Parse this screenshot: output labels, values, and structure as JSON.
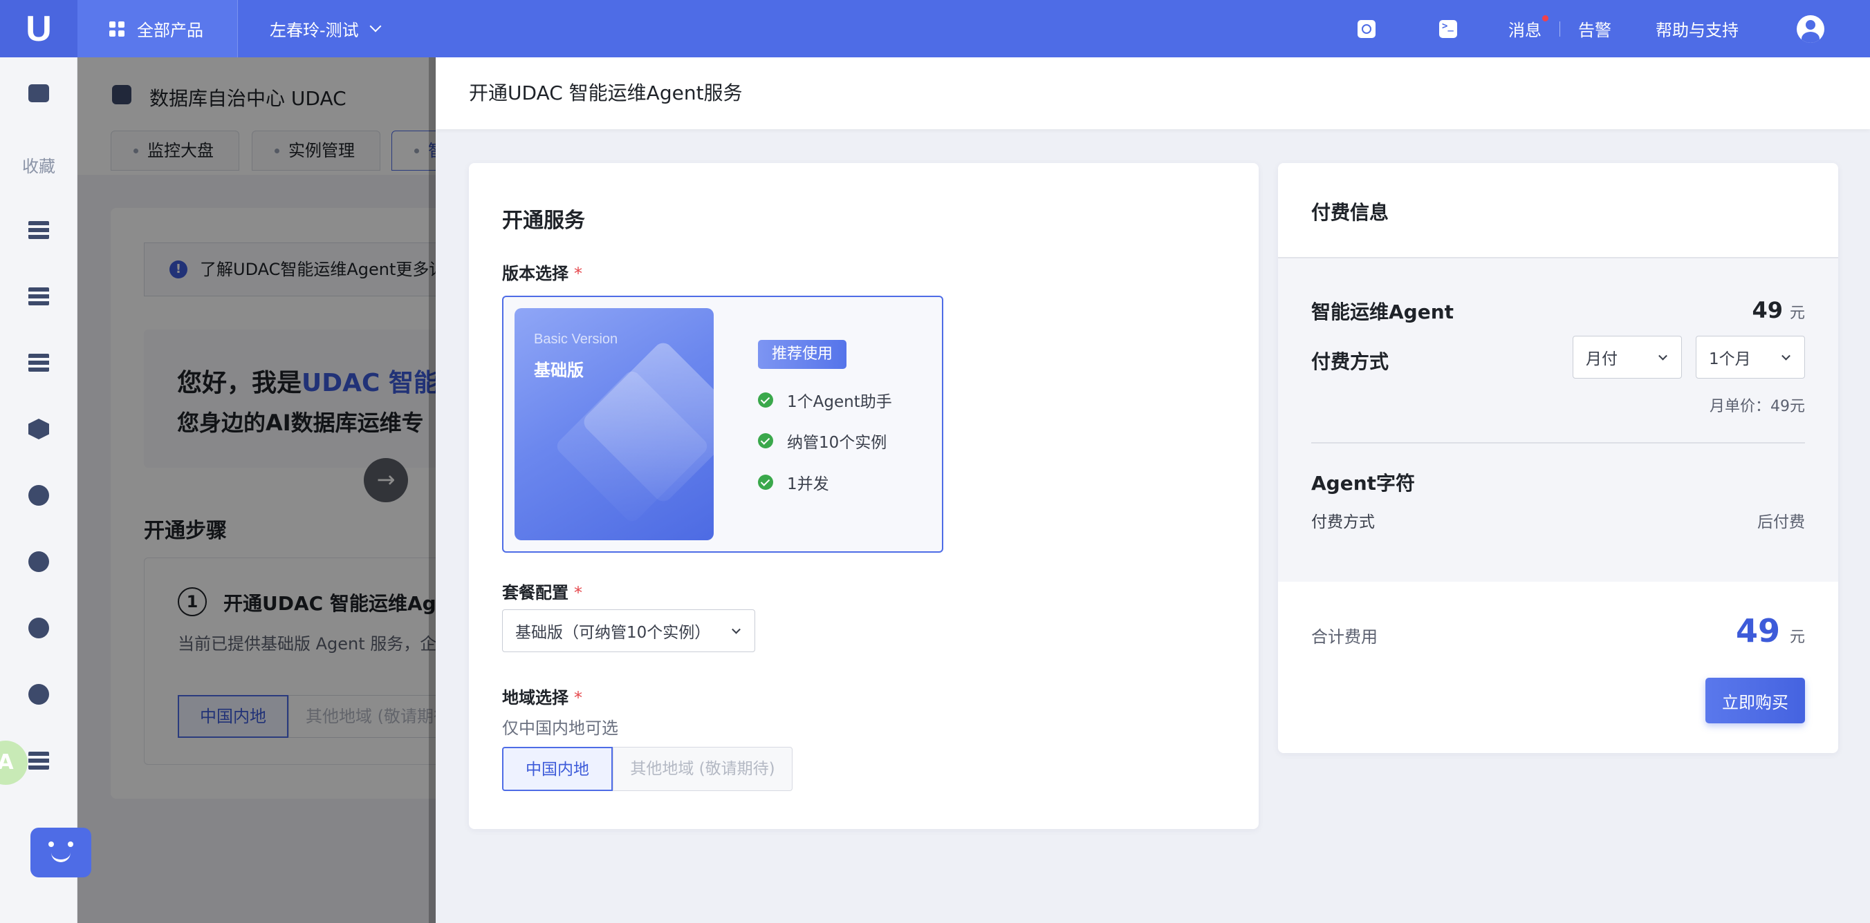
{
  "topbar": {
    "logo": "U",
    "all_products": "全部产品",
    "project": "左春玲-测试",
    "message": "消息",
    "alarm": "告警",
    "help": "帮助与支持"
  },
  "sidebar": {
    "favorites": "收藏",
    "translate_badge": "A"
  },
  "background_page": {
    "title": "数据库自治中心 UDAC",
    "tabs": [
      "监控大盘",
      "实例管理",
      "智"
    ],
    "notice": "了解UDAC智能运维Agent更多详",
    "hero_line1_prefix": "您好，我是",
    "hero_line1_highlight": "UDAC 智能运",
    "hero_line2": "您身边的AI数据库运维专",
    "steps_title": "开通步骤",
    "step_number": "1",
    "step_title": "开通UDAC 智能运维Agent",
    "step_desc": "当前已提供基础版 Agent 服务，企业",
    "region_active": "中国内地",
    "region_other": "其他地域 (敬请期待)"
  },
  "drawer": {
    "title": "开通UDAC 智能运维Agent服务",
    "service": {
      "title": "开通服务",
      "version_label": "版本选择",
      "required_mark": "*",
      "version": {
        "name_en": "Basic Version",
        "name_cn": "基础版",
        "badge": "推荐使用",
        "features": [
          "1个Agent助手",
          "纳管10个实例",
          "1并发"
        ]
      },
      "package_label": "套餐配置",
      "package_value": "基础版（可纳管10个实例）",
      "region_label": "地域选择",
      "region_hint": "仅中国内地可选",
      "region_options": [
        "中国内地",
        "其他地域 (敬请期待)"
      ]
    },
    "payment": {
      "title": "付费信息",
      "agent_name": "智能运维Agent",
      "agent_price": "49",
      "currency": "元",
      "pay_method_label": "付费方式",
      "pay_method_value": "月付",
      "duration_value": "1个月",
      "unit_price": "月单价：49元",
      "chars_title": "Agent字符",
      "chars_method_label": "付费方式",
      "chars_method_value": "后付费",
      "total_label": "合计费用",
      "total_price": "49",
      "buy_button": "立即购买"
    }
  },
  "colors": {
    "brand": "#4e6ce6",
    "accent_text": "#3d5bd9",
    "success": "#3aa84b",
    "required": "#e5484d"
  }
}
